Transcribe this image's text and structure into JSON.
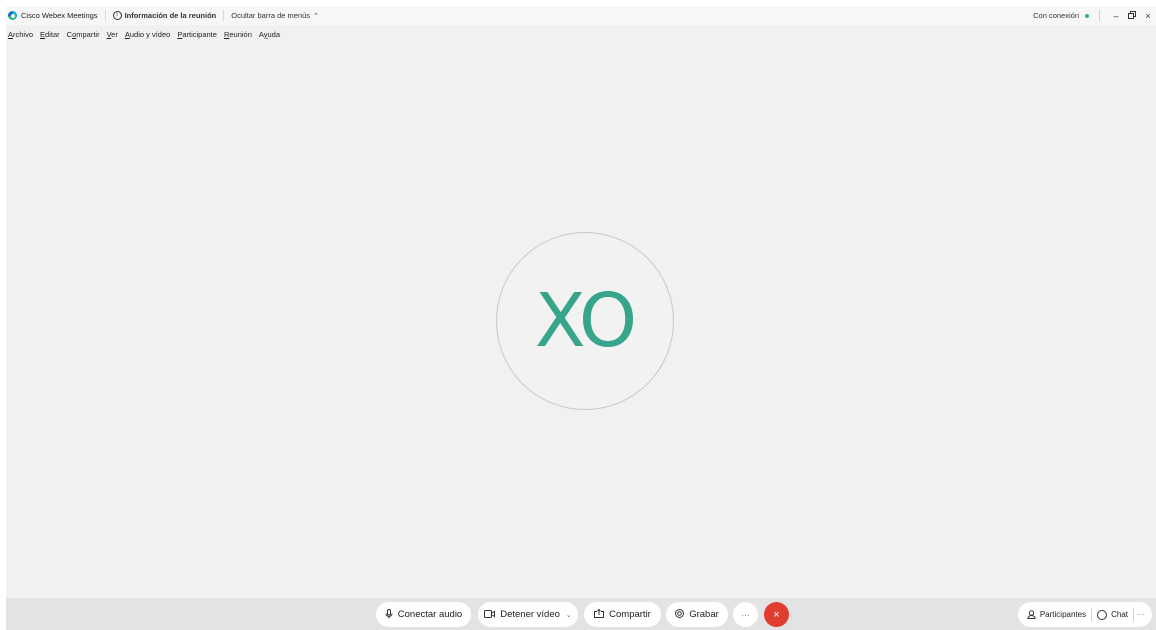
{
  "titlebar": {
    "app_title": "Cisco Webex Meetings",
    "meeting_info": "Información de la reunión",
    "hide_menubar": "Ocultar barra de menús",
    "connection_status": "Con conexión",
    "status_color": "#2bb673"
  },
  "menubar": {
    "items": [
      {
        "accel": "A",
        "rest": "rchivo"
      },
      {
        "accel": "E",
        "rest": "ditar"
      },
      {
        "pre": "C",
        "accel": "o",
        "rest": "mpartir"
      },
      {
        "accel": "V",
        "rest": "er"
      },
      {
        "accel": "A",
        "rest": "udio y vídeo"
      },
      {
        "accel": "P",
        "rest": "articipante"
      },
      {
        "accel": "R",
        "rest": "eunión"
      },
      {
        "pre": "A",
        "accel": "y",
        "rest": "uda"
      }
    ]
  },
  "stage": {
    "avatar_initials": "XO",
    "avatar_color": "#37a58c"
  },
  "controls": {
    "connect_audio": "Conectar audio",
    "stop_video": "Detener vídeo",
    "share": "Compartir",
    "record": "Grabar",
    "more": "···",
    "end_color": "#e03c2f"
  },
  "panels": {
    "participants": "Participantes",
    "chat": "Chat",
    "more": "···"
  },
  "icons": {
    "window_minimize": "–",
    "window_restore": "🗗",
    "window_close": "×",
    "end_meeting": "×",
    "mic": "🎙",
    "video": "▭",
    "share": "⇧",
    "record": "◎",
    "person": "⚲"
  }
}
